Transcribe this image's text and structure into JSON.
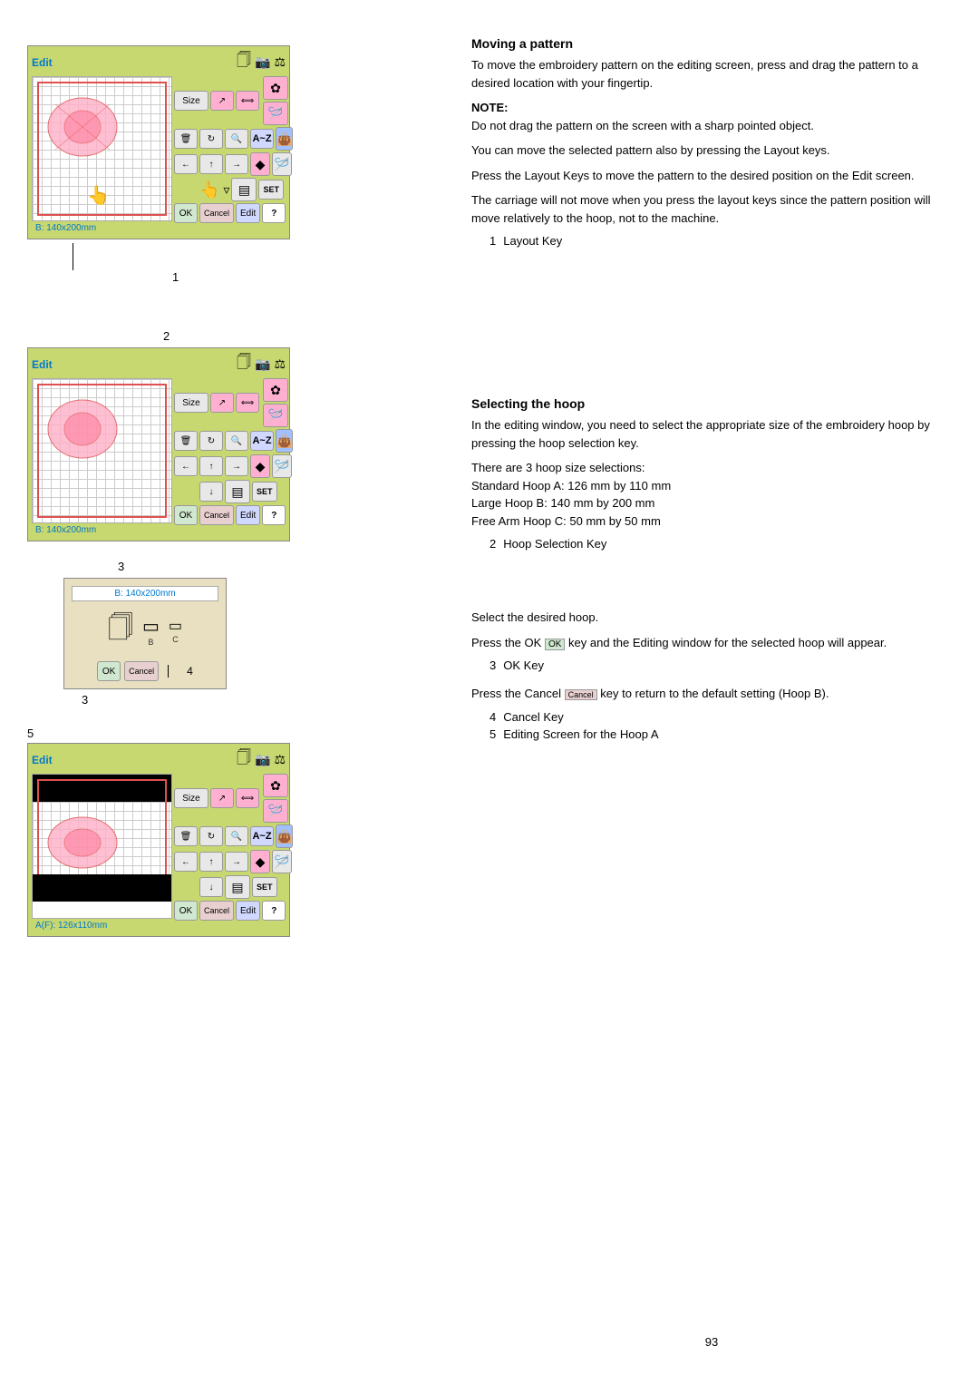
{
  "page": {
    "number": "93"
  },
  "section1": {
    "title": "Moving a pattern",
    "para1": "To move the embroidery pattern on the editing screen, press and drag the pattern to a desired location with your fingertip.",
    "note_label": "NOTE:",
    "note1": "Do not drag the pattern on the screen with a sharp pointed object.",
    "para2": "You can move the selected pattern also by pressing the Layout keys.",
    "para3": "Press the Layout Keys to move the pattern to the desired position on the Edit screen.",
    "para4": "The carriage will not move when you press the layout keys since the pattern position will move relatively to the hoop, not to the machine.",
    "callout1_label": "1",
    "callout1_text": "Layout Key",
    "diagram1_number": "1"
  },
  "section2": {
    "title": "Selecting the hoop",
    "para1": "In the editing window, you need to select the appropriate size of the embroidery hoop by pressing the hoop selection key.",
    "para2": "There are 3 hoop size selections:",
    "hoop_a": "Standard Hoop A: 126 mm by 110 mm",
    "hoop_b": "Large Hoop B: 140 mm by 200 mm",
    "hoop_c": "Free Arm Hoop C: 50 mm by 50 mm",
    "callout2_label": "2",
    "callout2_text": "Hoop Selection Key",
    "para3": "Select the desired hoop.",
    "para4": "Press the OK",
    "ok_key_inline": "OK",
    "para4b": "key and the Editing window for the selected hoop will appear.",
    "callout3_label": "3",
    "callout3_text": "OK Key",
    "para5": "Press the Cancel",
    "cancel_inline": "Cancel",
    "para5b": "key to return to the default setting (Hoop B).",
    "callout4_label": "4",
    "callout4_text": "Cancel Key",
    "callout5_label": "5",
    "callout5_text": "Editing Screen for the Hoop A",
    "diagram2_number": "2",
    "dialog_title": "B: 140x200mm",
    "hoop_b_label": "B",
    "hoop_c_label": "C",
    "diagram3_number": "3",
    "diagram4_number": "4",
    "diagram5_number": "5"
  },
  "screens": {
    "edit_label": "Edit",
    "size_label": "Size",
    "az_label": "A~Z",
    "set_label": "SET",
    "ok_label": "OK",
    "cancel_label": "Cancel",
    "edit_btn_label": "Edit",
    "question_label": "?",
    "hoop_size1": "B: 140x200mm",
    "hoop_size2": "B: 140x200mm",
    "hoop_size3": "A(F): 126x110mm"
  }
}
